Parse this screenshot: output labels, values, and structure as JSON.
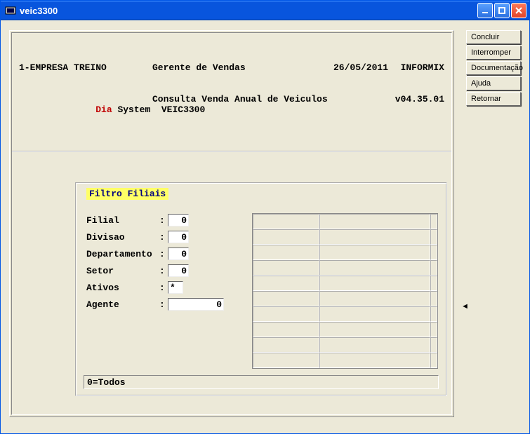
{
  "window": {
    "title": "veic3300"
  },
  "side_buttons": [
    "Concluir",
    "Interromper",
    "Documentação",
    "Ajuda",
    "Retornar"
  ],
  "header": {
    "company": "1-EMPRESA TREINO",
    "role": "Gerente de Vendas",
    "date": "26/05/2011",
    "db": "INFORMIX",
    "dia": "Dia",
    "system_lbl": "System",
    "system_code": "VEIC3300",
    "subtitle": "Consulta Venda Anual de Veiculos",
    "version": "v04.35.01"
  },
  "form": {
    "box_title": "Filtro Filiais",
    "rows": [
      {
        "label": "Filial",
        "value": "0",
        "cls": "small"
      },
      {
        "label": "Divisao",
        "value": "0",
        "cls": "small"
      },
      {
        "label": "Departamento",
        "value": "0",
        "cls": "small"
      },
      {
        "label": "Setor",
        "value": "0",
        "cls": "small"
      },
      {
        "label": "Ativos",
        "value": "*",
        "cls": "tiny"
      },
      {
        "label": "Agente",
        "value": "0",
        "cls": "med"
      }
    ],
    "status": "0=Todos"
  }
}
